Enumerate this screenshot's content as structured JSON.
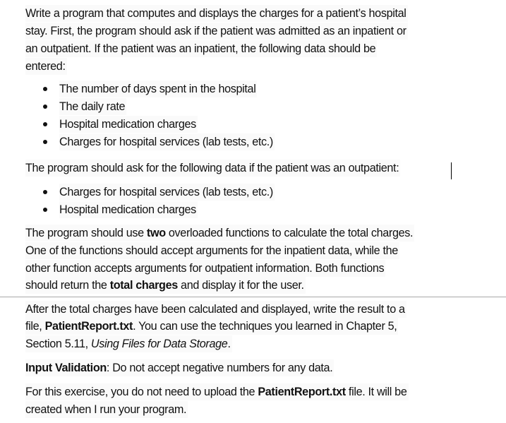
{
  "paragraph1": {
    "lines": [
      "Write a program that computes and displays the charges for a patient’s hospital",
      "stay. First, the program should ask if the patient was admitted as an inpatient or",
      "an outpatient. If the patient was an inpatient, the following data should be",
      "entered:"
    ]
  },
  "inpatient_list": {
    "items": [
      "The number of days spent in the hospital",
      "The daily rate",
      "Hospital medication charges",
      "Charges for hospital services (lab tests, etc.)"
    ]
  },
  "paragraph2": {
    "text": "The program should ask for the following data if the patient was an outpatient:"
  },
  "outpatient_list": {
    "items": [
      "Charges for hospital services (lab tests, etc.)",
      "Hospital medication charges"
    ]
  },
  "paragraph3": {
    "line1_pre": "The program should use ",
    "line1_bold": "two",
    "line1_post": " overloaded functions to calculate the total charges.",
    "line2": "One of the functions should accept arguments for the inpatient data, while the",
    "line3": "other function accepts arguments for outpatient information. Both functions",
    "line4_pre": "should return the ",
    "line4_bold": "total charges",
    "line4_post": " and display it for the user."
  },
  "paragraph4": {
    "line1": "After the total charges have been calculated and displayed, write the result to a",
    "line2_pre": "file, ",
    "line2_bold": "PatientReport.txt",
    "line2_post": ".  You can use the techniques you learned in Chapter 5,",
    "line3_pre": "Section 5.11, ",
    "line3_italic": "Using Files for Data Storage",
    "line3_post": "."
  },
  "input_validation": {
    "label": "Input Validation",
    "text": ": Do not accept negative numbers for any data."
  },
  "paragraph5": {
    "line1_pre": "For this exercise, you do not need to upload the ",
    "line1_bold": "PatientReport.txt",
    "line1_post": " file.  It will be",
    "line2": "created when I run your program."
  }
}
